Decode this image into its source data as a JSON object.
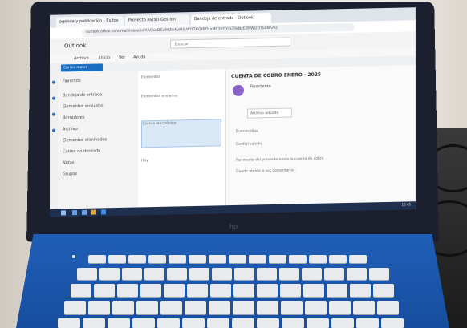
{
  "browser": {
    "tabs": [
      "agenda y publicación - Exitos",
      "Proyecto AVISO Gestion",
      "Bandeja de entrada - Outlook"
    ],
    "url": "outlook.office.com/mail/inbox/id/AAQkADEwMDlhNzM3LWI1ZGQtNDcxMC1hYjYxLThkNzE2MWI2OTk0NAAQ"
  },
  "outlook": {
    "brand": "Outlook",
    "search_placeholder": "Buscar",
    "menu": [
      "Archivo",
      "Inicio",
      "Ver",
      "Ayuda"
    ],
    "new_mail_label": "Correo nuevo",
    "folders": [
      "Favoritos",
      "Bandeja de entrada",
      "Elementos enviados",
      "Borradores",
      "Archivo",
      "Elementos eliminados",
      "Correo no deseado",
      "Notas",
      "Grupos"
    ],
    "messages": [
      "Elementos",
      "Elementos enviados",
      "Correo electrónico",
      "Hoy"
    ],
    "subject": "CUENTA DE COBRO ENERO - 2025",
    "sender": "Remitente",
    "attachment": "Archivo adjunto",
    "body_lines": [
      "Buenos días,",
      "Cordial saludo,",
      "Por medio del presente envío la cuenta de cobro.",
      "Quedo atenta a sus comentarios."
    ]
  },
  "taskbar": {
    "time": "10:45"
  },
  "laptop": {
    "brand_mark": "hp"
  }
}
